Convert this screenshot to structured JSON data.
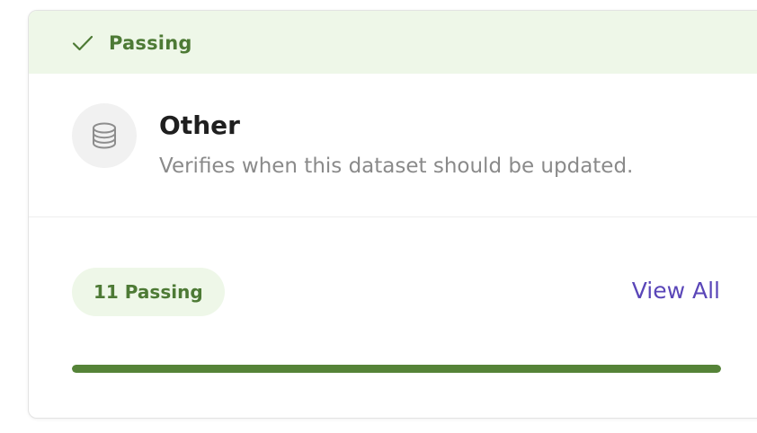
{
  "colors": {
    "passing_text": "#4d7a35",
    "passing_background": "#eef7e8",
    "link": "#5a46b8",
    "progress_fill": "#558338"
  },
  "status": {
    "icon": "check-icon",
    "label": "Passing"
  },
  "check": {
    "icon": "database-icon",
    "title": "Other",
    "description": "Verifies when this dataset should be updated."
  },
  "summary": {
    "count_label": "11 Passing",
    "view_all_label": "View All",
    "progress_fraction": 1.0
  }
}
